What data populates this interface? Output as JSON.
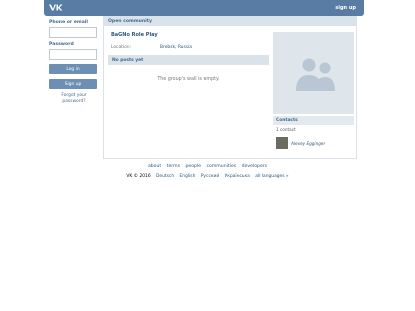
{
  "header": {
    "signup_label": "sign up"
  },
  "login": {
    "phone_label": "Phone or email",
    "password_label": "Password",
    "login_button": "Log in",
    "signup_button": "Sign up",
    "forgot_line1": "Forgot your",
    "forgot_line2": "password?"
  },
  "community": {
    "section_label": "Open community",
    "title": "BaGNo Role Play",
    "location_label": "Location:",
    "location_value": "Brebsk, Russia",
    "no_posts": "No posts yet",
    "wall_empty": "The group's wall is empty."
  },
  "contacts": {
    "label": "Contacts",
    "count": "1 contact",
    "name": "Alexey Egginger"
  },
  "footer": {
    "links": [
      "about",
      "terms",
      "people",
      "communities",
      "developers"
    ],
    "copyright": "VK © 2016",
    "languages": [
      "Deutsch",
      "English",
      "Русский",
      "Українська",
      "all languages »"
    ]
  },
  "colors": {
    "header_bg": "#587ca3",
    "button_bg": "#6d8fb3",
    "link": "#2b587a"
  }
}
